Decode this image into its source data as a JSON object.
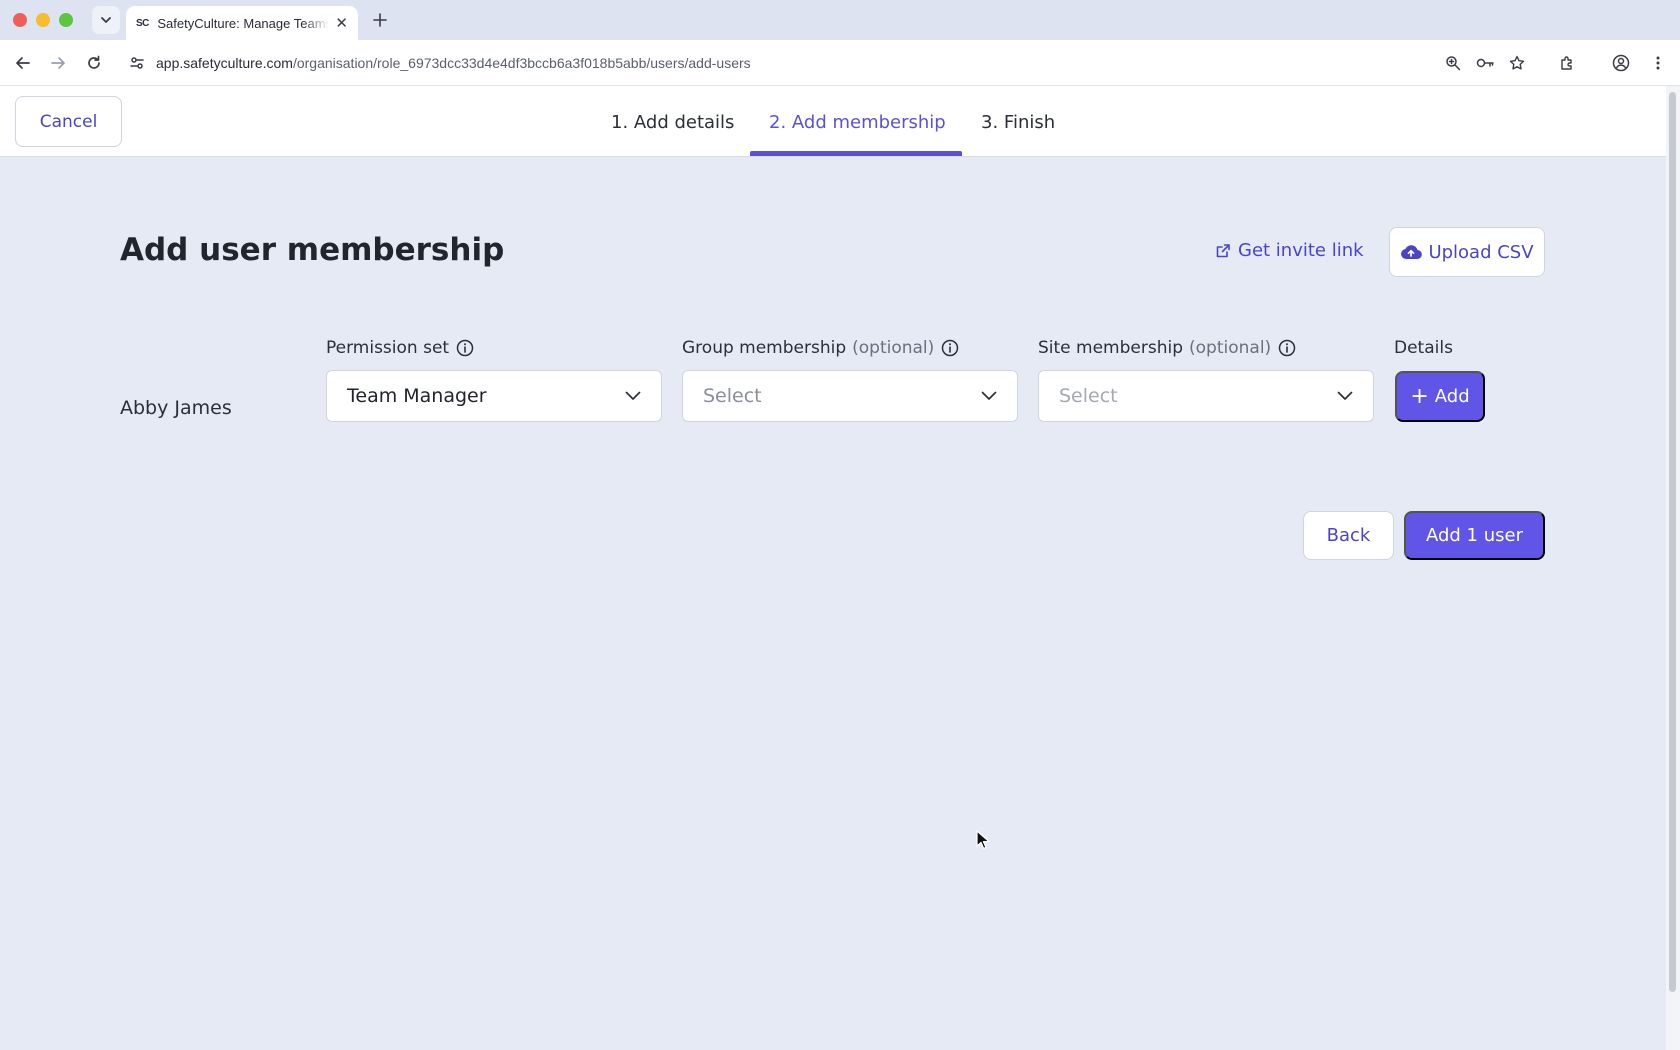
{
  "browser": {
    "tab_title": "SafetyCulture: Manage Teams",
    "tab_favicon": "SC",
    "url_host": "app.safetyculture.com",
    "url_path": "/organisation/role_6973dcc33d4e4df3bccb6a3f018b5abb/users/add-users"
  },
  "header": {
    "cancel_label": "Cancel",
    "steps": [
      {
        "label": "1. Add details",
        "active": false
      },
      {
        "label": "2. Add membership",
        "active": true
      },
      {
        "label": "3. Finish",
        "active": false
      }
    ]
  },
  "main": {
    "title": "Add user membership",
    "invite_link_label": "Get invite link",
    "upload_csv_label": "Upload CSV",
    "columns": {
      "permission_set": "Permission set",
      "group_membership": "Group membership",
      "site_membership": "Site membership",
      "optional_suffix": "(optional)",
      "details": "Details"
    },
    "rows": [
      {
        "name": "Abby James",
        "permission_set_value": "Team Manager",
        "group_placeholder": "Select",
        "site_placeholder": "Select",
        "add_label": "Add"
      }
    ],
    "back_label": "Back",
    "submit_label": "Add 1 user"
  },
  "colors": {
    "accent": "#6155e8",
    "link": "#4b44c8",
    "page_background": "#e6eaf4"
  }
}
